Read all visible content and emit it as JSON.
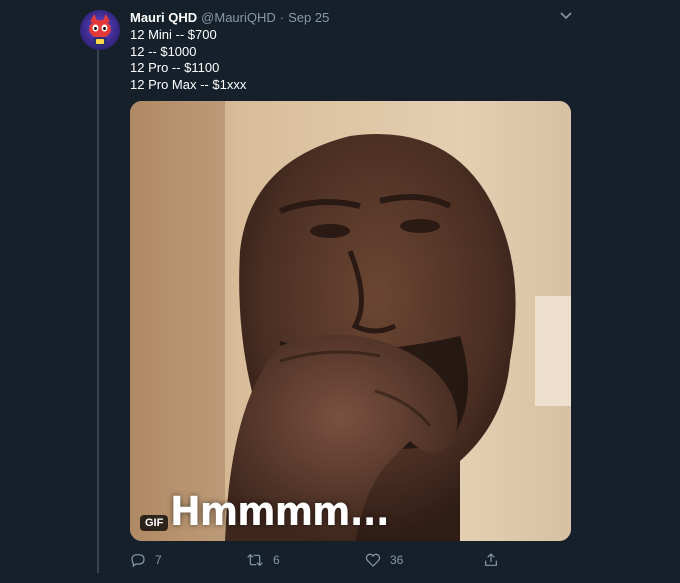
{
  "tweet": {
    "name": "Mauri QHD",
    "handle": "@MauriQHD",
    "separator": "·",
    "date": "Sep 25",
    "lines": [
      "12 Mini -- $700",
      "12 -- $1000",
      "12 Pro -- $1100",
      "12 Pro Max -- $1xxx"
    ],
    "media": {
      "badge": "GIF",
      "caption": "Hmmmm...",
      "alt_subject": "man thinking with hand on chin"
    }
  },
  "actions": {
    "reply": {
      "icon": "reply-icon",
      "count": "7"
    },
    "retweet": {
      "icon": "retweet-icon",
      "count": "6"
    },
    "like": {
      "icon": "heart-icon",
      "count": "36"
    },
    "share": {
      "icon": "share-icon"
    }
  },
  "colors": {
    "background": "#15202b",
    "text": "#ffffff",
    "secondary": "#8899a6",
    "thread_line": "#38444d"
  }
}
